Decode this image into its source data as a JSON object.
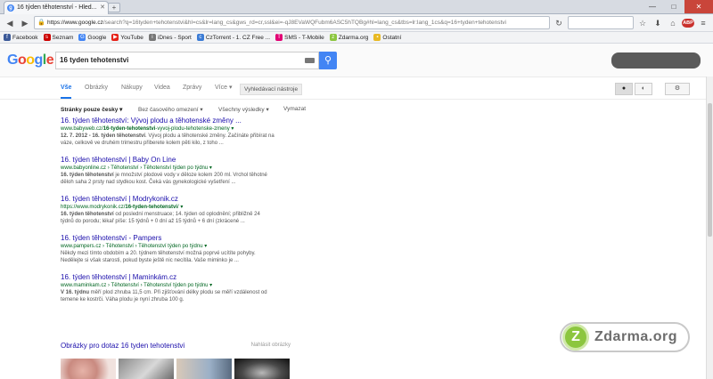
{
  "browser": {
    "tab_title": "16 týden těhotenství - Hled...",
    "url_domain": "https://www.google.cz",
    "url_rest": "/search?q=16tyden+tehotenstvi&hl=cs&lr=lang_cs&gws_rd=cr,ssl&ei=-qJ8EVaWQFubm6ASC5hTQBg#hl=lang_cs&tbs=lr:lang_1cs&q=16+tyden+tehotenstvi",
    "window_controls": [
      "—",
      "□",
      "✕"
    ],
    "bookmarks": [
      {
        "label": "Facebook",
        "icon": "f",
        "color": "#3b5998"
      },
      {
        "label": "Seznam",
        "icon": "s",
        "color": "#cc0000"
      },
      {
        "label": "Google",
        "icon": "G",
        "color": "#4285f4"
      },
      {
        "label": "YouTube",
        "icon": "▶",
        "color": "#e62117"
      },
      {
        "label": "iDnes - Sport",
        "icon": "i",
        "color": "#777777"
      },
      {
        "label": "CzTorrent - 1. CZ Free ...",
        "icon": "c",
        "color": "#3a7bd5"
      },
      {
        "label": "SMS - T-Mobile",
        "icon": "T",
        "color": "#e20074"
      },
      {
        "label": "Zdarma.org",
        "icon": "z",
        "color": "#8cc63f"
      },
      {
        "label": "Ostatní",
        "icon": "▪",
        "color": "#e8b923"
      }
    ]
  },
  "google": {
    "logo_letters": [
      "G",
      "o",
      "o",
      "g",
      "l",
      "e"
    ],
    "query": "16 tyden tehotenstvi",
    "tabs": [
      "Vše",
      "Obrázky",
      "Nákupy",
      "Videa",
      "Zprávy",
      "Více ▾"
    ],
    "tools_label": "Vyhledávací nástroje",
    "filters": [
      "Stránky pouze česky ▾",
      "Bez časového omezení ▾",
      "Všechny výsledky ▾",
      "Vymazat"
    ],
    "results": [
      {
        "title": "16. týden těhotenství: Vývoj plodu a těhotenské změny ...",
        "url_pre": "www.babyweb.cz/",
        "url_bold": "16-tyden-tehotenstvi",
        "url_post": "-vyvoj-plodu-tehotenske-zmeny ▾",
        "snippet_bold": "12. 7. 2012 - 16. týden těhotenství",
        "snippet": ". Vývoj plodu a těhotenské změny. Začínáte přibírat na váze, celkově ve druhém trimestru přiberete kolem pěti kilo, z toho ..."
      },
      {
        "title": "16. týden těhotenství | Baby On Line",
        "url_pre": "www.babyonline.cz › Těhotenství › Těhotenství týden po týdnu ▾",
        "url_bold": "",
        "url_post": "",
        "snippet_bold": "16. týden těhotenství",
        "snippet": " je množství plodové vody v děloze kolem 200 ml. Vrchol těhotné děloh saha 2 prsty nad stydkou kost. Čeká vás gynekologické vyšetření ..."
      },
      {
        "title": "16. týden těhotenství | Modrykonik.cz",
        "url_pre": "https://www.modrykonik.cz/",
        "url_bold": "16-tyden-tehotenstvi",
        "url_post": "/ ▾",
        "snippet_bold": "16. týden těhotenství",
        "snippet": " od poslední menstruace; 14. týden od oplodnění; přibližně 24 týdnů do porodu; lékař píše: 15 týdnů + 0 dní až 15 týdnů + 6 dní (zkrácené ..."
      },
      {
        "title": "16. týden těhotenství - Pampers",
        "url_pre": "www.pampers.cz › Těhotenství › Těhotenství týden po týdnu ▾",
        "url_bold": "",
        "url_post": "",
        "snippet_bold": "",
        "snippet": "Někdy mezi tímto obdobím a 20. týdnem těhotenství možná poprvé ucítíte pohyby. Nedělejte si však starosti, pokud byste ještě nic necítila. Vaše miminko je ..."
      },
      {
        "title": "16. týden těhotenství | Maminkám.cz",
        "url_pre": "www.maminkam.cz › Těhotenství › Těhotenství týden po týdnu ▾",
        "url_bold": "",
        "url_post": "",
        "snippet_bold": "V 16. týdnu",
        "snippet": " měří plod zhruba 11,5 cm. Při zjišťování délky plodu se měří vzdálenost od temene ke kostrči. Váha plodu je nyní zhruba 100 g."
      }
    ],
    "images_header": "Obrázky pro dotaz 16 tyden tehotenstvi",
    "report_images": "Nahlásit obrázky"
  },
  "watermark": {
    "letter": "Z",
    "text": "Zdarma.org"
  }
}
